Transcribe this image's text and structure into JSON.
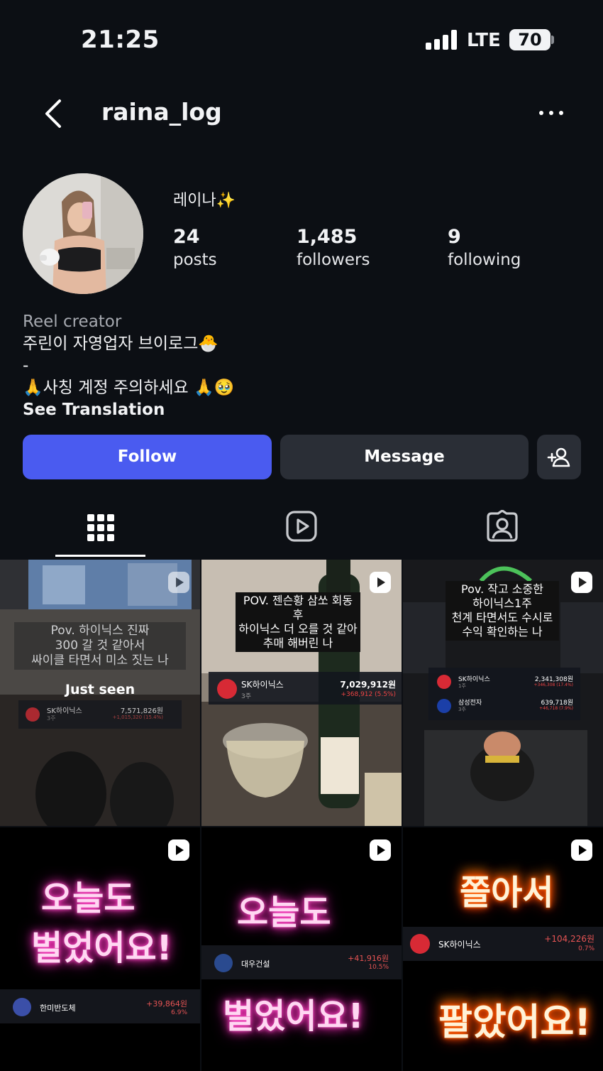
{
  "status_bar": {
    "time": "21:25",
    "network": "LTE",
    "battery": "70"
  },
  "header": {
    "username": "raina_log",
    "back_icon": "chevron-left-icon",
    "more_icon": "ellipsis-icon"
  },
  "profile": {
    "display_name": "레이나✨",
    "stats": [
      {
        "value": "24",
        "label": "posts"
      },
      {
        "value": "1,485",
        "label": "followers"
      },
      {
        "value": "9",
        "label": "following"
      }
    ],
    "bio": {
      "category": "Reel creator",
      "line1": "주린이 자영업자 브이로그🐣",
      "line2": "-",
      "line3": "🙏사칭 계정 주의하세요 🙏🥹",
      "see_translation": "See Translation"
    }
  },
  "actions": {
    "follow": "Follow",
    "message": "Message",
    "add_person_icon": "add-person-icon"
  },
  "tabs": [
    {
      "name": "posts-grid",
      "icon": "grid-icon",
      "active": true
    },
    {
      "name": "reels",
      "icon": "reels-icon",
      "active": false
    },
    {
      "name": "tagged",
      "icon": "tagged-icon",
      "active": false
    }
  ],
  "posts": [
    {
      "caption": [
        "Pov. 하이닉스 진짜",
        "300 갈 것 같아서",
        "싸이클 타면서 미소 짓는 나"
      ],
      "badge": "Just seen",
      "stock": {
        "name": "SK하이닉스",
        "qty": "3주",
        "amount": "7,571,826원",
        "change": "+1,015,320 (15.4%)"
      }
    },
    {
      "caption": [
        "POV. 젠슨황 삼쏘 회동 후",
        "하이닉스 더 오를 것 같아",
        "추매 해버린 나"
      ],
      "stock": {
        "name": "SK하이닉스",
        "qty": "3주",
        "amount": "7,029,912원",
        "change": "+368,912 (5.5%)"
      }
    },
    {
      "caption": [
        "Pov. 작고 소중한",
        "하이닉스1주",
        "천계 타면서도 수시로",
        "수익 확인하는 나"
      ],
      "stocks": [
        {
          "name": "SK하이닉스",
          "qty": "1주",
          "amount": "2,341,308원",
          "change": "+346,308 (17.4%)"
        },
        {
          "name": "삼성전자",
          "qty": "3주",
          "amount": "639,718원",
          "change": "+46,718 (7.9%)"
        }
      ]
    },
    {
      "text1": "오늘도",
      "text2": "벌었어요!",
      "stock": {
        "name": "한미반도체",
        "amount": "+39,864원",
        "pct": "6.9%"
      }
    },
    {
      "text1": "오늘도",
      "text2": "벌었어요!",
      "stock": {
        "name": "대우건설",
        "amount": "+41,916원",
        "pct": "10.5%"
      }
    },
    {
      "text1": "쫄아서",
      "text2": "팔았어요!",
      "stock": {
        "name": "SK하이닉스",
        "amount": "+104,226원",
        "pct": "0.7%"
      }
    }
  ]
}
